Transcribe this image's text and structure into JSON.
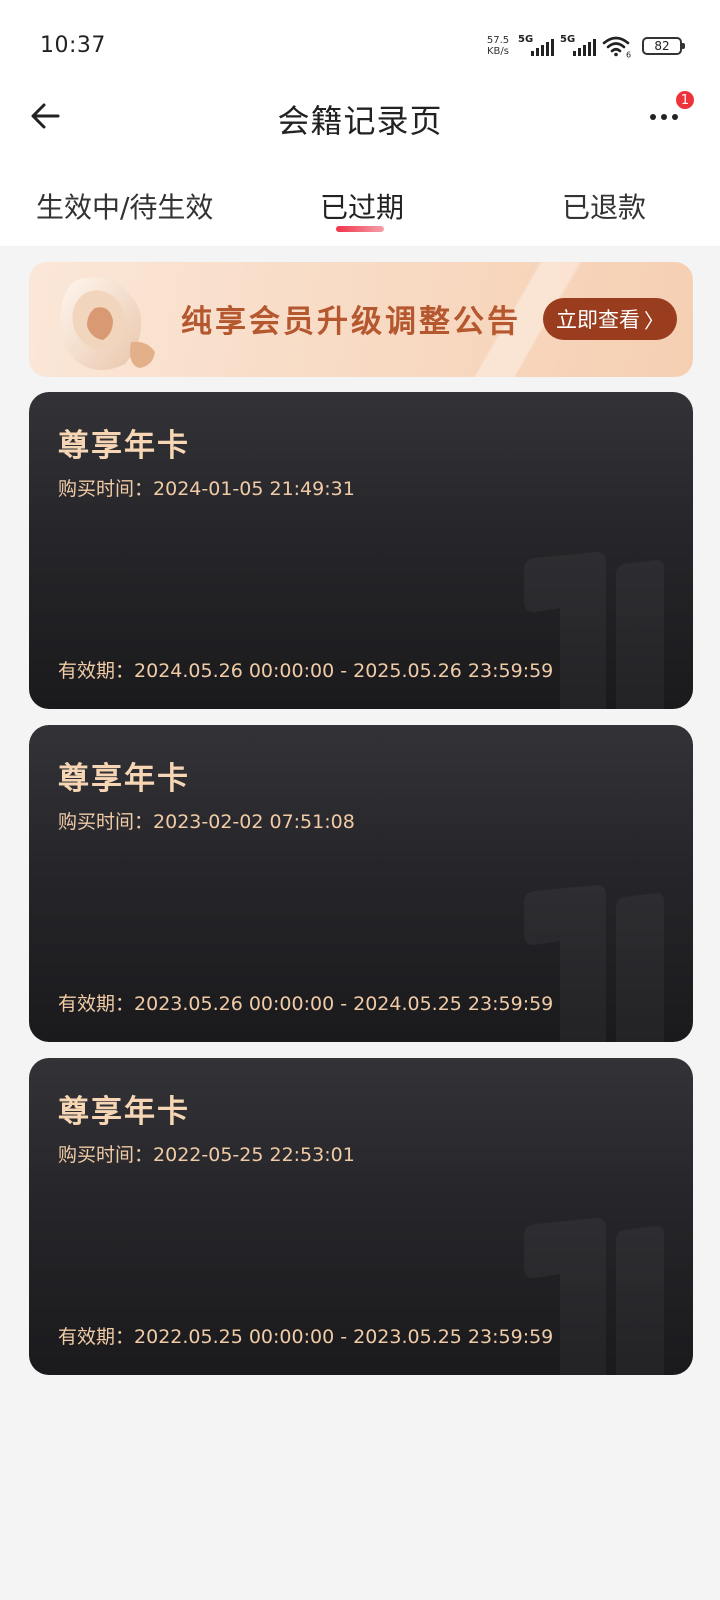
{
  "status_bar": {
    "time": "10:37",
    "net_speed_value": "57.5",
    "net_speed_unit": "KB/s",
    "sim1": "5G",
    "sim2": "5G",
    "wifi_label": "6",
    "battery": "82"
  },
  "header": {
    "title": "会籍记录页",
    "notification_count": "1"
  },
  "tabs": [
    {
      "label": "生效中/待生效",
      "active": false
    },
    {
      "label": "已过期",
      "active": true
    },
    {
      "label": "已退款",
      "active": false
    }
  ],
  "banner": {
    "text": "纯享会员升级调整公告",
    "button_label": "立即查看",
    "button_chevron": "〉"
  },
  "cards": [
    {
      "title": "尊享年卡",
      "purchase_label": "购买时间：",
      "purchase_time": "2024-01-05 21:49:31",
      "validity_label": "有效期：",
      "validity": "2024.05.26 00:00:00 - 2025.05.26 23:59:59"
    },
    {
      "title": "尊享年卡",
      "purchase_label": "购买时间：",
      "purchase_time": "2023-02-02 07:51:08",
      "validity_label": "有效期：",
      "validity": "2023.05.26 00:00:00 - 2024.05.25 23:59:59"
    },
    {
      "title": "尊享年卡",
      "purchase_label": "购买时间：",
      "purchase_time": "2022-05-25 22:53:01",
      "validity_label": "有效期：",
      "validity": "2022.05.25 00:00:00 - 2023.05.25 23:59:59"
    }
  ],
  "colors": {
    "accent_red": "#f0323a",
    "card_gold_text": "#f0cba6",
    "banner_button": "#9a3d1f"
  }
}
